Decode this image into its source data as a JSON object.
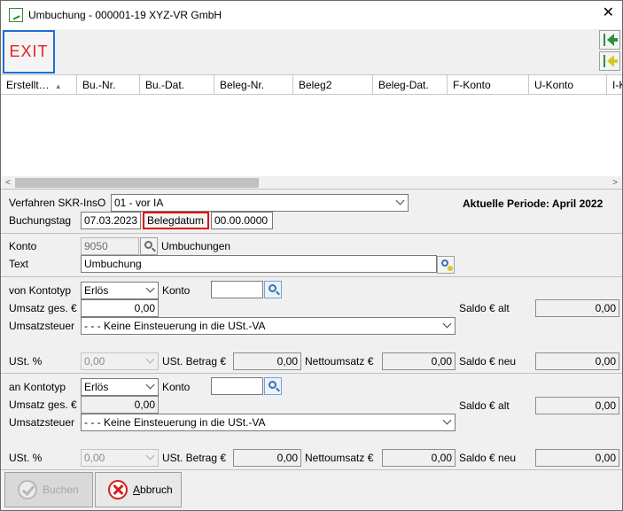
{
  "window": {
    "title": "Umbuchung - 000001-19 XYZ-VR GmbH",
    "close": "✕"
  },
  "toolbar": {
    "exit_label": "EXIT",
    "side_buttons": [
      "arrow-left-green-icon",
      "arrow-left-yellow-icon"
    ]
  },
  "grid": {
    "columns": [
      "Erstellt…",
      "Bu.-Nr.",
      "Bu.-Dat.",
      "Beleg-Nr.",
      "Beleg2",
      "Beleg-Dat.",
      "F-Konto",
      "U-Konto",
      "I-K"
    ],
    "rows": []
  },
  "header": {
    "verfahren_label": "Verfahren SKR-InsO",
    "verfahren_value": "01 - vor IA",
    "periode": "Aktuelle Periode: April 2022",
    "buchungstag_label": "Buchungstag",
    "buchungstag_value": "07.03.2023",
    "belegdatum_label": "Belegdatum",
    "belegdatum_value": "00.00.0000"
  },
  "konto_section": {
    "konto_label": "Konto",
    "konto_value": "9050",
    "konto_name": "Umbuchungen",
    "text_label": "Text",
    "text_value": "Umbuchung"
  },
  "von": {
    "kontotyp_label": "von Kontotyp",
    "kontotyp_value": "Erlös",
    "konto_label": "Konto",
    "konto_value": "",
    "umsatz_label": "Umsatz ges. €",
    "umsatz_value": "0,00",
    "saldo_alt_label": "Saldo € alt",
    "saldo_alt_value": "0,00",
    "ust_label": "Umsatzsteuer",
    "ust_value": "- - - Keine Einsteuerung in die USt.-VA",
    "ust_pct_label": "USt. %",
    "ust_pct_value": "0,00",
    "ust_betrag_label": "USt. Betrag €",
    "ust_betrag_value": "0,00",
    "netto_label": "Nettoumsatz €",
    "netto_value": "0,00",
    "saldo_neu_label": "Saldo € neu",
    "saldo_neu_value": "0,00"
  },
  "an": {
    "kontotyp_label": "an Kontotyp",
    "kontotyp_value": "Erlös",
    "konto_label": "Konto",
    "konto_value": "",
    "umsatz_label": "Umsatz ges. €",
    "umsatz_value": "0,00",
    "saldo_alt_label": "Saldo € alt",
    "saldo_alt_value": "0,00",
    "ust_label": "Umsatzsteuer",
    "ust_value": "- - - Keine Einsteuerung in die USt.-VA",
    "ust_pct_label": "USt. %",
    "ust_pct_value": "0,00",
    "ust_betrag_label": "USt. Betrag €",
    "ust_betrag_value": "0,00",
    "netto_label": "Nettoumsatz €",
    "netto_value": "0,00",
    "saldo_neu_label": "Saldo € neu",
    "saldo_neu_value": "0,00"
  },
  "footer": {
    "buchen_label": "Buchen",
    "abbruch_first": "A",
    "abbruch_rest": "bbruch"
  },
  "colors": {
    "exit_text": "#e12020",
    "focus_border": "#1e6fd6",
    "highlight_border": "#e01010",
    "arrow_green": "#2d8f3a",
    "arrow_yellow": "#d8c52a"
  }
}
